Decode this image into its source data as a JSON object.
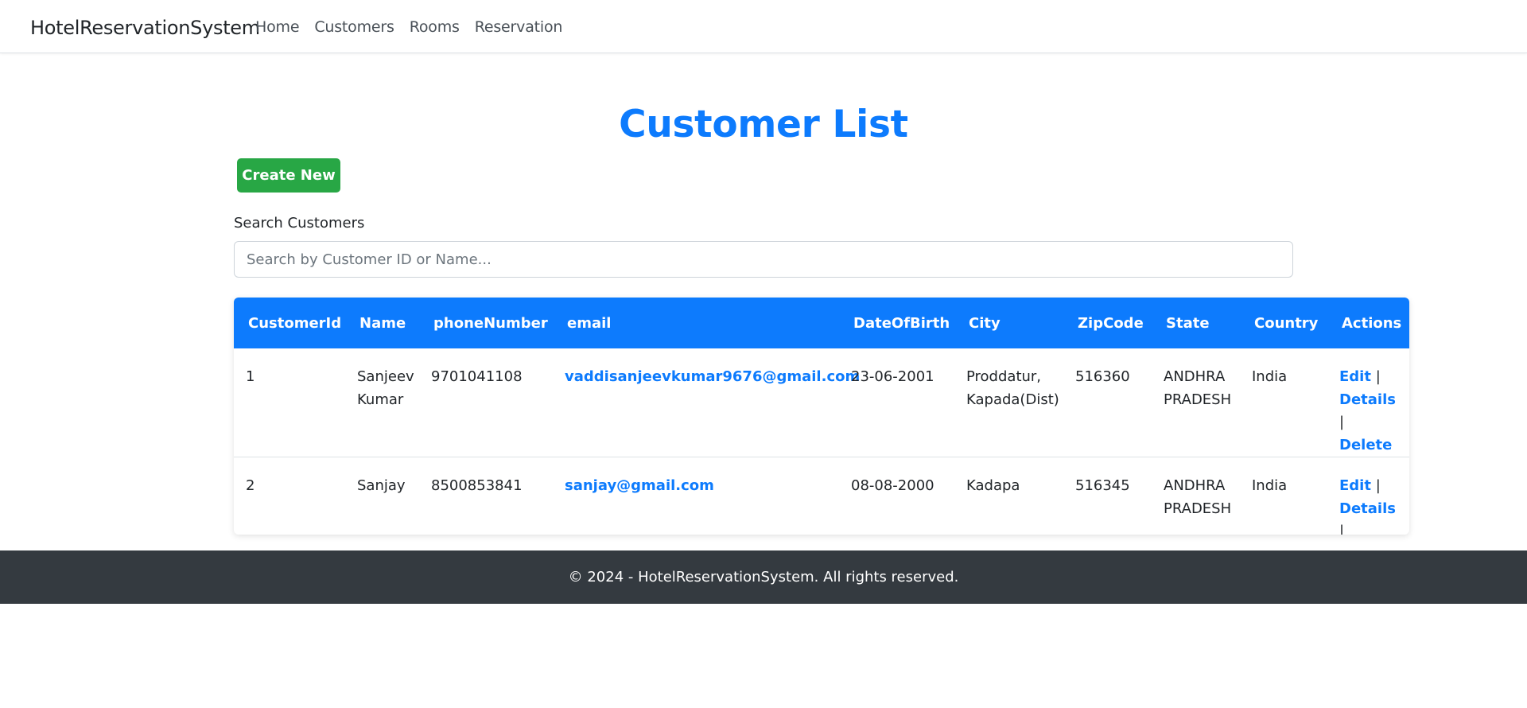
{
  "navbar": {
    "brand": "HotelReservationSystem",
    "links": [
      "Home",
      "Customers",
      "Rooms",
      "Reservation"
    ]
  },
  "page": {
    "title": "Customer List",
    "create_button": "Create New",
    "search_label": "Search Customers",
    "search_placeholder": "Search by Customer ID or Name...",
    "search_value": ""
  },
  "table": {
    "headers": [
      "CustomerId",
      "Name",
      "phoneNumber",
      "email",
      "DateOfBirth",
      "City",
      "ZipCode",
      "State",
      "Country",
      "Actions"
    ],
    "rows": [
      {
        "id": "1",
        "name": "Sanjeev Kumar",
        "phone": "9701041108",
        "email": "vaddisanjeevkumar9676@gmail.com",
        "dob": "23-06-2001",
        "city": "Proddatur, Kapada(Dist)",
        "zip": "516360",
        "state": "ANDHRA PRADESH",
        "country": "India"
      },
      {
        "id": "2",
        "name": "Sanjay",
        "phone": "8500853841",
        "email": "sanjay@gmail.com",
        "dob": "08-08-2000",
        "city": "Kadapa",
        "zip": "516345",
        "state": "ANDHRA PRADESH",
        "country": "India"
      }
    ],
    "actions": {
      "edit": "Edit",
      "details": "Details",
      "delete": "Delete",
      "separator": "|"
    }
  },
  "footer": {
    "text": "© 2024 - HotelReservationSystem. All rights reserved."
  },
  "colors": {
    "primary": "#0d7bfd",
    "success": "#28a745",
    "footer_bg": "#343a40"
  }
}
